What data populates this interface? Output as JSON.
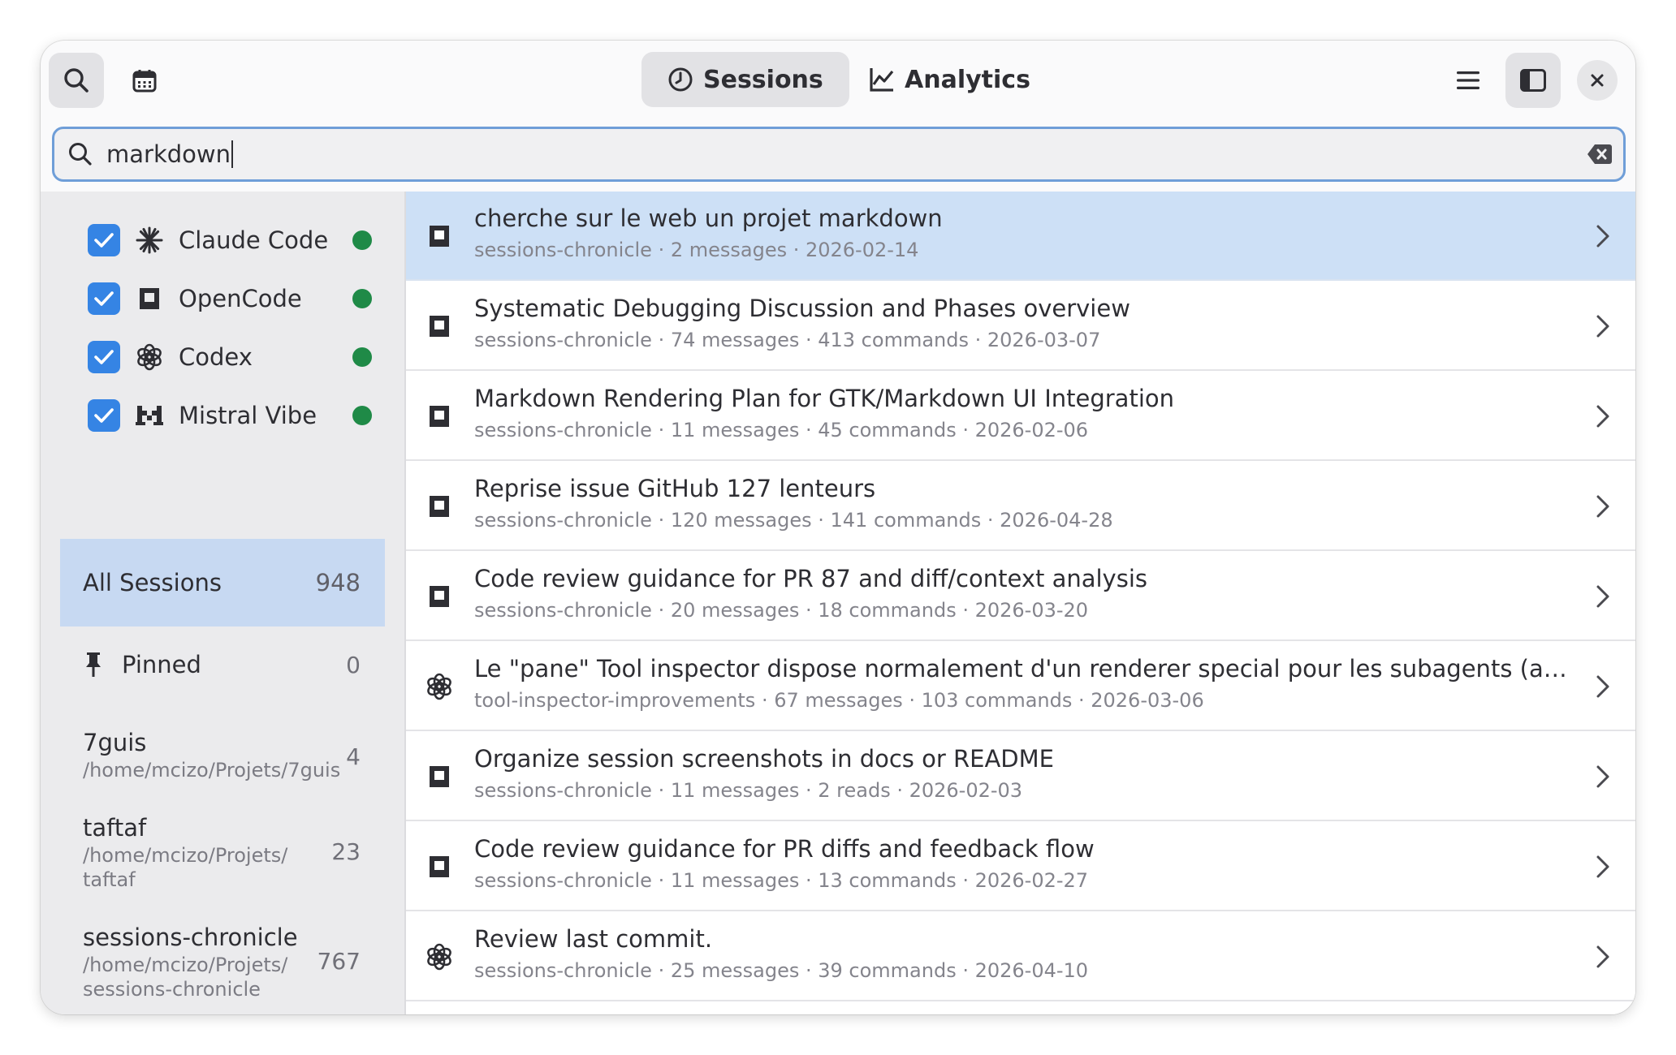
{
  "header": {
    "tabs": [
      {
        "label": "Sessions",
        "active": true,
        "icon": "clock-icon"
      },
      {
        "label": "Analytics",
        "active": false,
        "icon": "chart-line-icon"
      }
    ]
  },
  "search": {
    "value": "markdown",
    "placeholder": ""
  },
  "agents": [
    {
      "label": "Claude Code",
      "checked": true,
      "icon": "claude-icon",
      "status": "online"
    },
    {
      "label": "OpenCode",
      "checked": true,
      "icon": "opencode-icon",
      "status": "online"
    },
    {
      "label": "Codex",
      "checked": true,
      "icon": "openai-icon",
      "status": "online"
    },
    {
      "label": "Mistral Vibe",
      "checked": true,
      "icon": "mistral-icon",
      "status": "online"
    }
  ],
  "filters": {
    "all_sessions": {
      "label": "All Sessions",
      "count": "948"
    },
    "pinned": {
      "label": "Pinned",
      "count": "0"
    }
  },
  "projects": [
    {
      "name": "7guis",
      "path": "/home/mcizo/Projets/7guis",
      "count": "4"
    },
    {
      "name": "taftaf",
      "path": "/home/mcizo/Projets/ taftaf",
      "count": "23"
    },
    {
      "name": "sessions-chronicle",
      "path": "/home/mcizo/Projets/ sessions-chronicle",
      "count": "767"
    }
  ],
  "sessions": [
    {
      "title": "cherche sur le web un projet markdown",
      "meta": "sessions-chronicle · 2 messages · 2026-02-14",
      "agent_icon": "opencode-icon",
      "selected": true
    },
    {
      "title": "Systematic Debugging Discussion and Phases overview",
      "meta": "sessions-chronicle · 74 messages · 413 commands · 2026-03-07",
      "agent_icon": "opencode-icon",
      "selected": false
    },
    {
      "title": "Markdown Rendering Plan for GTK/Markdown UI Integration",
      "meta": "sessions-chronicle · 11 messages · 45 commands · 2026-02-06",
      "agent_icon": "opencode-icon",
      "selected": false
    },
    {
      "title": "Reprise issue GitHub 127 lenteurs",
      "meta": "sessions-chronicle · 120 messages · 141 commands · 2026-04-28",
      "agent_icon": "opencode-icon",
      "selected": false
    },
    {
      "title": "Code review guidance for PR 87 and diff/context analysis",
      "meta": "sessions-chronicle · 20 messages · 18 commands · 2026-03-20",
      "agent_icon": "opencode-icon",
      "selected": false
    },
    {
      "title": "Le \"pane\" Tool inspector dispose normalement d'un renderer special pour les subagents (au mo...",
      "meta": "tool-inspector-improvements · 67 messages · 103 commands · 2026-03-06",
      "agent_icon": "openai-icon",
      "selected": false
    },
    {
      "title": "Organize session screenshots in docs or README",
      "meta": "sessions-chronicle · 11 messages · 2 reads · 2026-02-03",
      "agent_icon": "opencode-icon",
      "selected": false
    },
    {
      "title": "Code review guidance for PR diffs and feedback flow",
      "meta": "sessions-chronicle · 11 messages · 13 commands · 2026-02-27",
      "agent_icon": "opencode-icon",
      "selected": false
    },
    {
      "title": "Review last commit.",
      "meta": "sessions-chronicle · 25 messages · 39 commands · 2026-04-10",
      "agent_icon": "openai-icon",
      "selected": false
    }
  ],
  "colors": {
    "accent": "#3584e4",
    "selection": "#cde0f6",
    "status_online": "#1f8a47"
  }
}
